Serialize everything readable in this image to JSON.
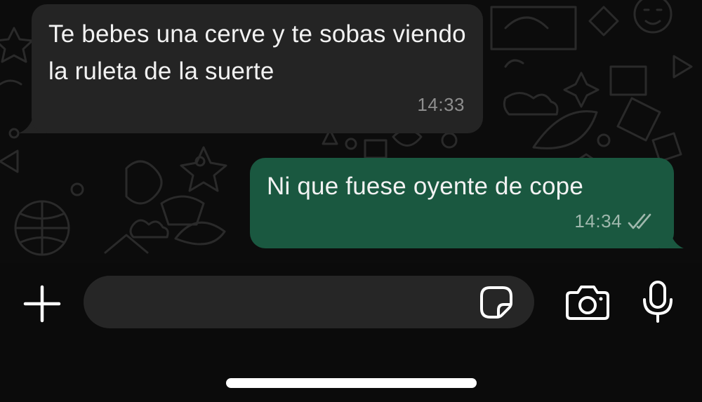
{
  "messages": [
    {
      "direction": "incoming",
      "text": "Te bebes una cerve y te sobas viendo la ruleta de la suerte",
      "time": "14:33"
    },
    {
      "direction": "outgoing",
      "text": "Ni que fuese oyente de cope",
      "time": "14:34",
      "status": "read-double-check-icon"
    }
  ],
  "composer": {
    "placeholder": "",
    "value": "",
    "icons": {
      "attach": "plus-icon",
      "sticker": "sticker-icon",
      "camera": "camera-icon",
      "mic": "microphone-icon"
    }
  },
  "colors": {
    "chat_background": "#0c0c0c",
    "incoming_bubble": "#242424",
    "outgoing_bubble": "#1a5840",
    "input_field": "#262626",
    "icon_color": "#ffffff",
    "timestamp": "#8e8e8e"
  }
}
